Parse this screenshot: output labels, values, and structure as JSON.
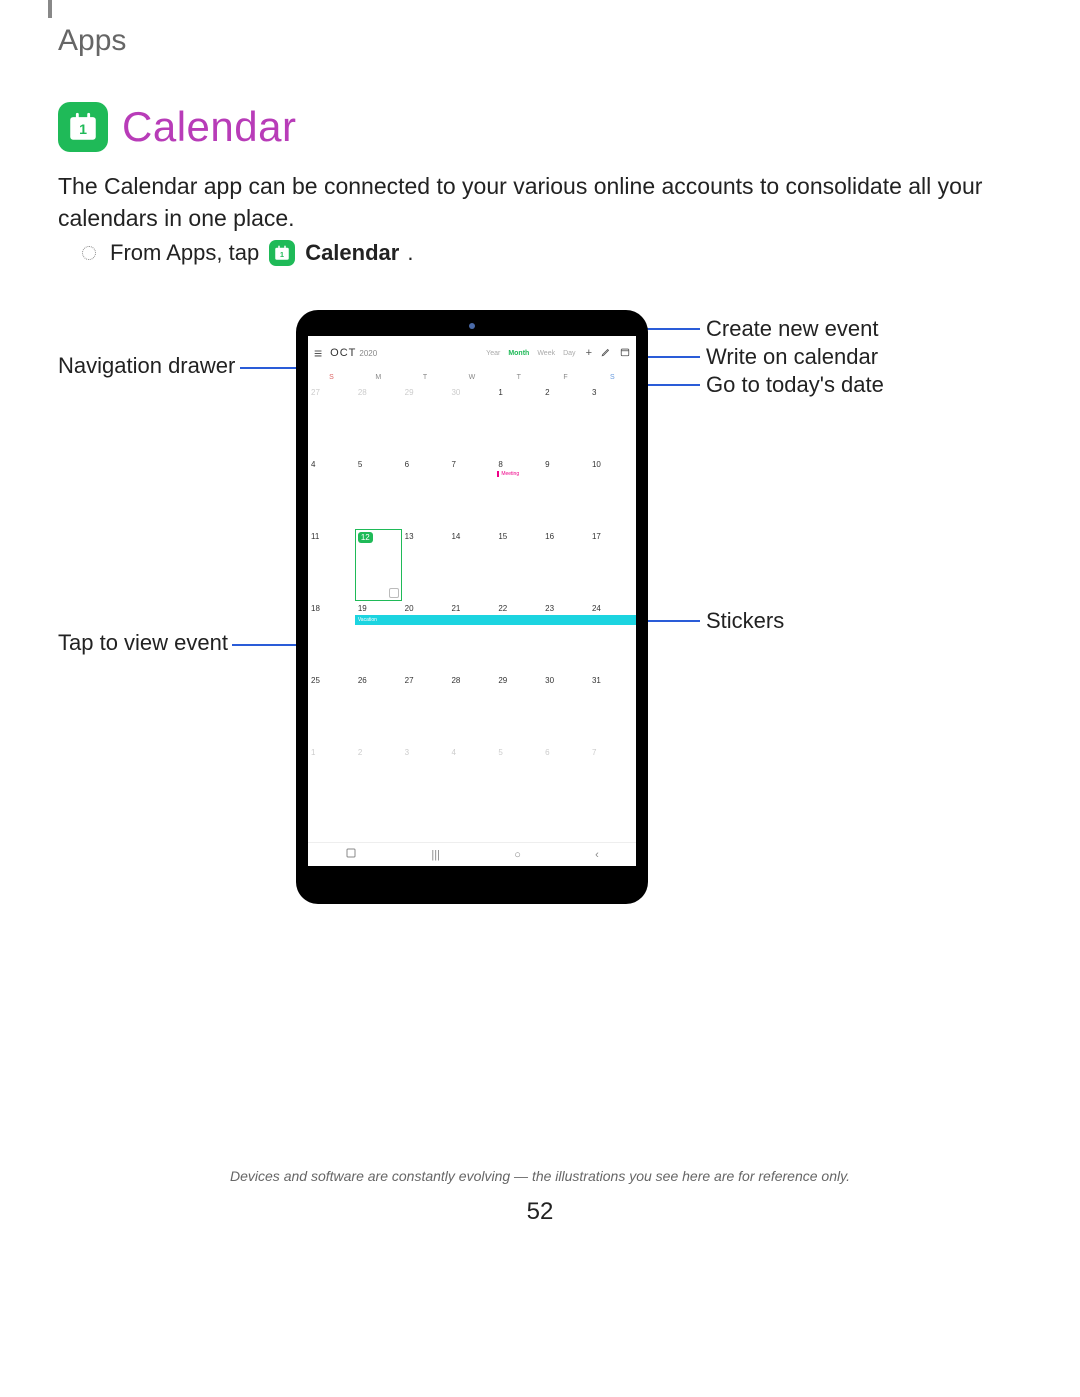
{
  "breadcrumb": "Apps",
  "section_title": "Calendar",
  "description": "The Calendar app can be connected to your various online accounts to consolidate all your calendars in one place.",
  "instruction": {
    "prefix": "From Apps, tap",
    "app_name": "Calendar",
    "suffix": "."
  },
  "callouts": {
    "navigation_drawer": "Navigation drawer",
    "tap_view_event": "Tap to view event",
    "create_event": "Create new event",
    "write_calendar": "Write on calendar",
    "today_date": "Go to today's date",
    "stickers": "Stickers"
  },
  "tablet_calendar": {
    "month": "OCT",
    "year": "2020",
    "view_tabs": [
      "Year",
      "Month",
      "Week",
      "Day"
    ],
    "active_tab": "Month",
    "day_heads": [
      "S",
      "M",
      "T",
      "W",
      "T",
      "F",
      "S"
    ],
    "weeks": [
      {
        "cells": [
          {
            "n": "27",
            "dim": true
          },
          {
            "n": "28",
            "dim": true
          },
          {
            "n": "29",
            "dim": true
          },
          {
            "n": "30",
            "dim": true
          },
          {
            "n": "1"
          },
          {
            "n": "2"
          },
          {
            "n": "3"
          }
        ]
      },
      {
        "cells": [
          {
            "n": "4"
          },
          {
            "n": "5"
          },
          {
            "n": "6"
          },
          {
            "n": "7"
          },
          {
            "n": "8",
            "event_label": "Meeting"
          },
          {
            "n": "9"
          },
          {
            "n": "10"
          }
        ]
      },
      {
        "cells": [
          {
            "n": "11"
          },
          {
            "n": "12",
            "today": true,
            "selected": true,
            "sticker": true
          },
          {
            "n": "13"
          },
          {
            "n": "14"
          },
          {
            "n": "15"
          },
          {
            "n": "16"
          },
          {
            "n": "17"
          }
        ]
      },
      {
        "cells": [
          {
            "n": "18"
          },
          {
            "n": "19"
          },
          {
            "n": "20"
          },
          {
            "n": "21"
          },
          {
            "n": "22"
          },
          {
            "n": "23"
          },
          {
            "n": "24"
          }
        ],
        "event_bar": "Vacation"
      },
      {
        "cells": [
          {
            "n": "25"
          },
          {
            "n": "26"
          },
          {
            "n": "27"
          },
          {
            "n": "28"
          },
          {
            "n": "29"
          },
          {
            "n": "30"
          },
          {
            "n": "31"
          }
        ]
      },
      {
        "cells": [
          {
            "n": "1",
            "dim": true
          },
          {
            "n": "2",
            "dim": true
          },
          {
            "n": "3",
            "dim": true
          },
          {
            "n": "4",
            "dim": true
          },
          {
            "n": "5",
            "dim": true
          },
          {
            "n": "6",
            "dim": true
          },
          {
            "n": "7",
            "dim": true
          }
        ]
      }
    ]
  },
  "footer_note": "Devices and software are constantly evolving — the illustrations you see here are for reference only.",
  "page_number": "52"
}
